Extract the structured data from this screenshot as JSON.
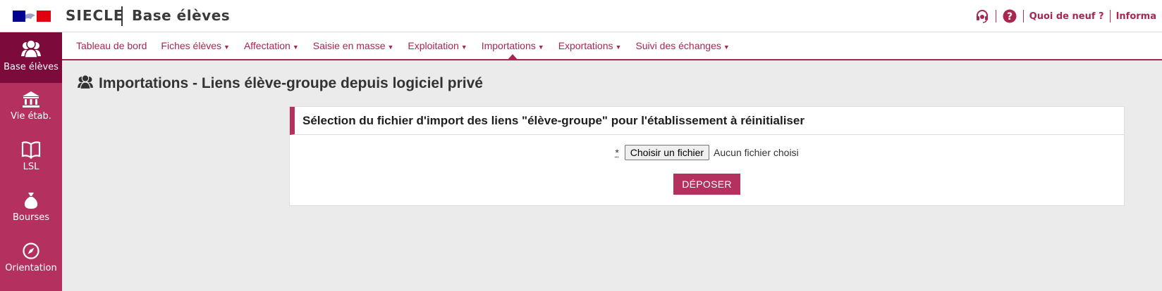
{
  "header": {
    "brand": "SIECLE",
    "app_name": "Base élèves",
    "links": [
      "Quoi de neuf ?",
      "Informa"
    ]
  },
  "sidebar": {
    "items": [
      {
        "label": "Base élèves",
        "icon": "users-icon",
        "active": true
      },
      {
        "label": "Vie étab.",
        "icon": "building-icon",
        "active": false
      },
      {
        "label": "LSL",
        "icon": "book-icon",
        "active": false
      },
      {
        "label": "Bourses",
        "icon": "money-bag-icon",
        "active": false
      },
      {
        "label": "Orientation",
        "icon": "compass-icon",
        "active": false
      }
    ]
  },
  "nav": {
    "items": [
      {
        "label": "Tableau de bord",
        "dropdown": false
      },
      {
        "label": "Fiches élèves",
        "dropdown": true
      },
      {
        "label": "Affectation",
        "dropdown": true
      },
      {
        "label": "Saisie en masse",
        "dropdown": true
      },
      {
        "label": "Exploitation",
        "dropdown": true
      },
      {
        "label": "Importations",
        "dropdown": true,
        "current": true
      },
      {
        "label": "Exportations",
        "dropdown": true
      },
      {
        "label": "Suivi des échanges",
        "dropdown": true
      }
    ]
  },
  "page": {
    "title": "Importations - Liens élève-groupe depuis logiciel privé"
  },
  "panel": {
    "title": "Sélection du fichier d'import des liens \"élève-groupe\" pour l'établissement à réinitialiser",
    "required_mark": "*",
    "file_button": "Choisir un fichier",
    "file_status": "Aucun fichier choisi",
    "submit_label": "DÉPOSER"
  },
  "colors": {
    "accent": "#b4305f",
    "sidebar_active": "#7c0a3a",
    "link": "#a8264f",
    "background": "#ebebeb"
  }
}
